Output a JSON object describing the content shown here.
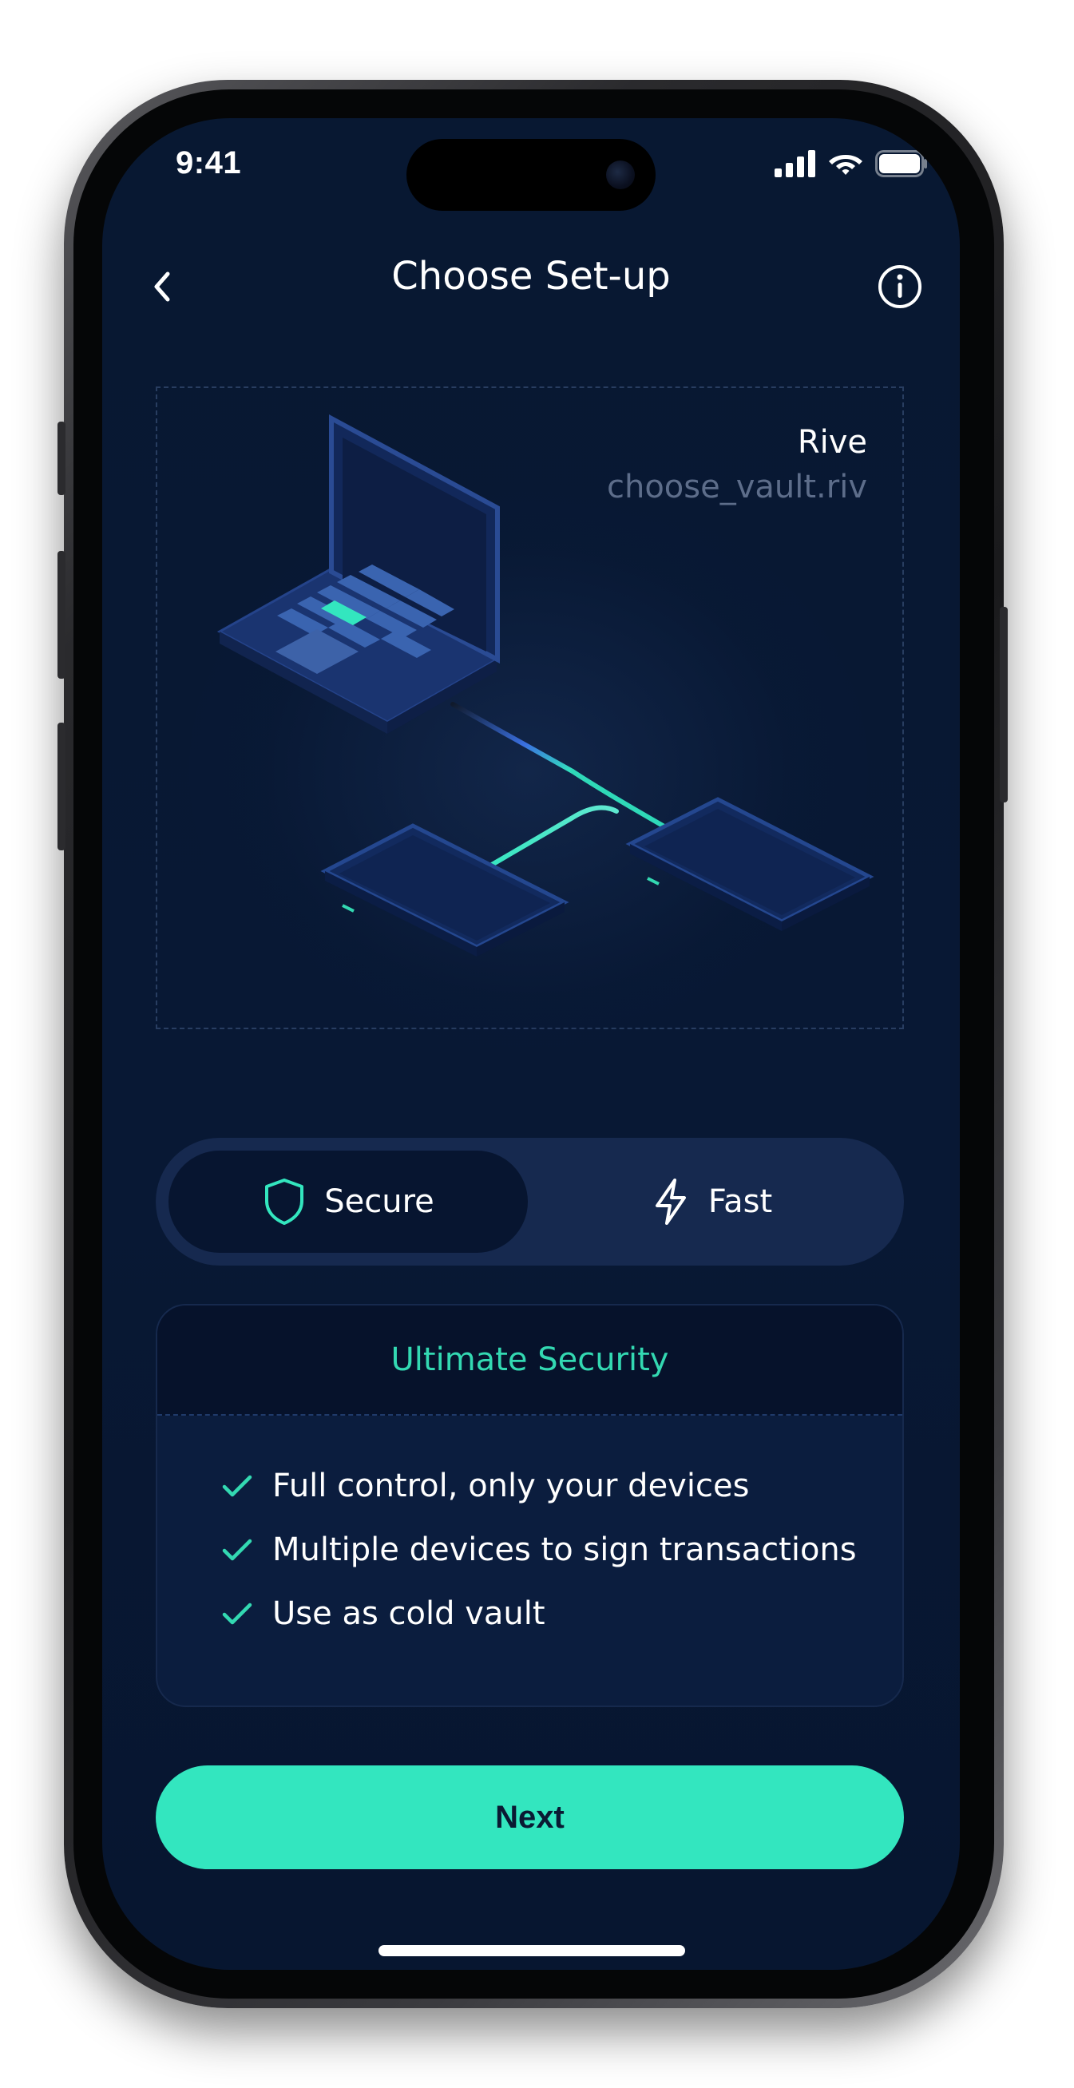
{
  "status_bar": {
    "time": "9:41",
    "icons": [
      "cellular-signal-icon",
      "wifi-icon",
      "battery-icon"
    ]
  },
  "header": {
    "title": "Choose Set-up",
    "back_icon": "chevron-left-icon",
    "info_icon": "info-icon"
  },
  "illustration": {
    "title": "Rive",
    "file": "choose_vault.riv"
  },
  "segment": {
    "options": [
      {
        "label": "Secure",
        "icon": "shield-icon",
        "selected": true
      },
      {
        "label": "Fast",
        "icon": "lightning-icon",
        "selected": false
      }
    ]
  },
  "card": {
    "title": "Ultimate Security",
    "features": [
      "Full control, only your devices",
      "Multiple devices to sign transactions",
      "Use as cold vault"
    ]
  },
  "next_button": {
    "label": "Next"
  },
  "colors": {
    "background": "#081832",
    "accent": "#33e6bf",
    "accent_text": "#33d9b2",
    "segment_track": "#16294f",
    "segment_active": "#071530"
  }
}
